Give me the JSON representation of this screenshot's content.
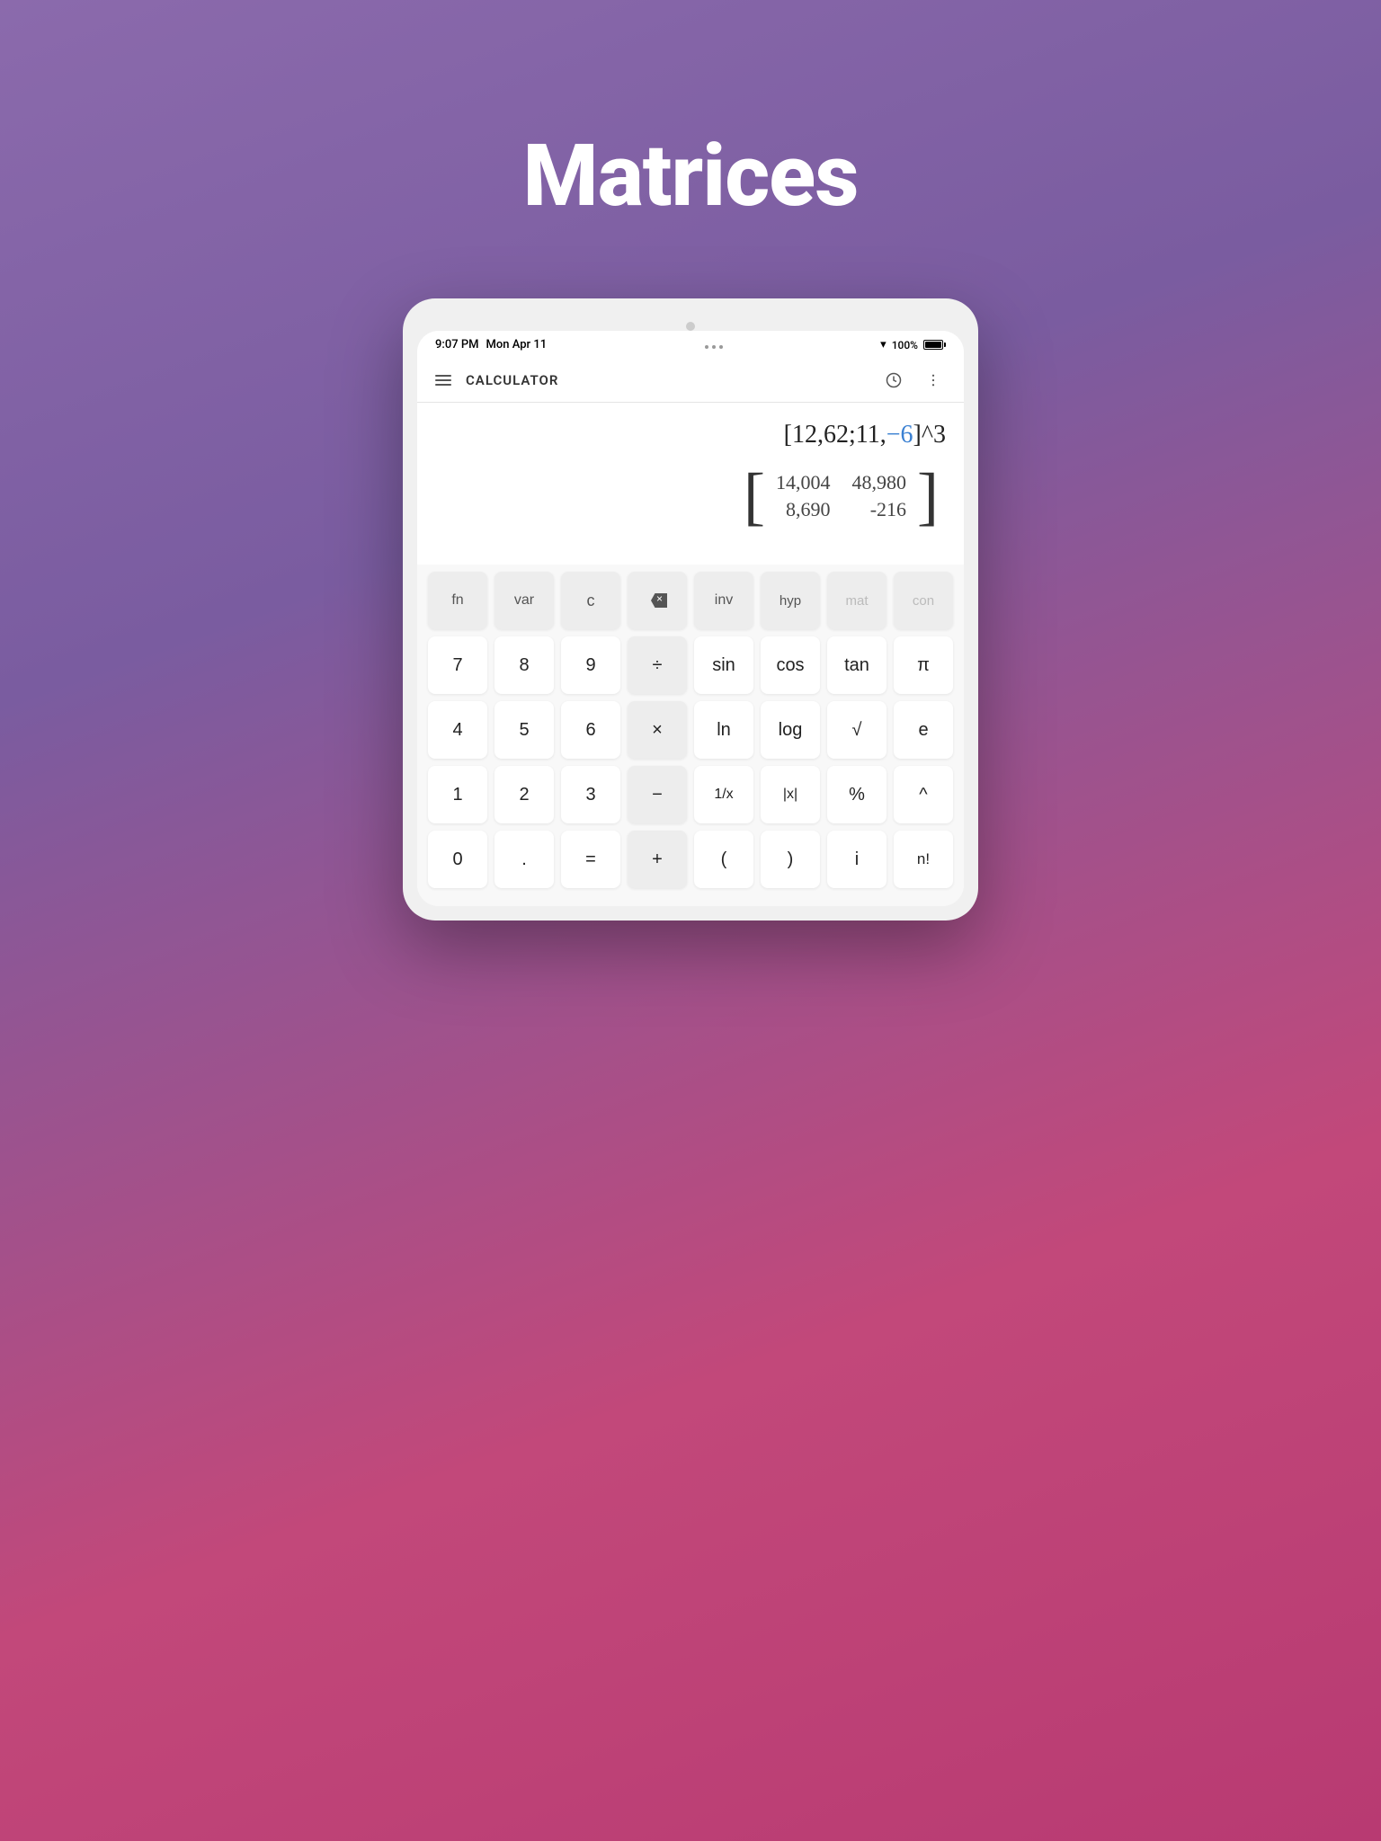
{
  "page": {
    "title": "Matrices",
    "background_color_top": "#8b6aac",
    "background_color_bottom": "#b83a72"
  },
  "status_bar": {
    "time": "9:07 PM",
    "date": "Mon Apr 11",
    "wifi": "WiFi",
    "battery": "100%"
  },
  "toolbar": {
    "title": "CALCULATOR",
    "history_icon": "history",
    "more_icon": "more-vertical"
  },
  "display": {
    "expression": "[12,62;11,−6]^3",
    "matrix_result": {
      "row1_col1": "14,004",
      "row1_col2": "48,980",
      "row2_col1": "8,690",
      "row2_col2": "-216"
    }
  },
  "keypad": {
    "rows": [
      [
        "fn",
        "var",
        "c",
        "⌫",
        "inv",
        "hyp",
        "mat",
        "con"
      ],
      [
        "7",
        "8",
        "9",
        "÷",
        "sin",
        "cos",
        "tan",
        "π"
      ],
      [
        "4",
        "5",
        "6",
        "×",
        "ln",
        "log",
        "√",
        "e"
      ],
      [
        "1",
        "2",
        "3",
        "−",
        "1/x",
        "|x|",
        "%",
        "^"
      ],
      [
        "0",
        ".",
        "=",
        "+",
        "(",
        ")",
        "i",
        "n!"
      ]
    ]
  }
}
